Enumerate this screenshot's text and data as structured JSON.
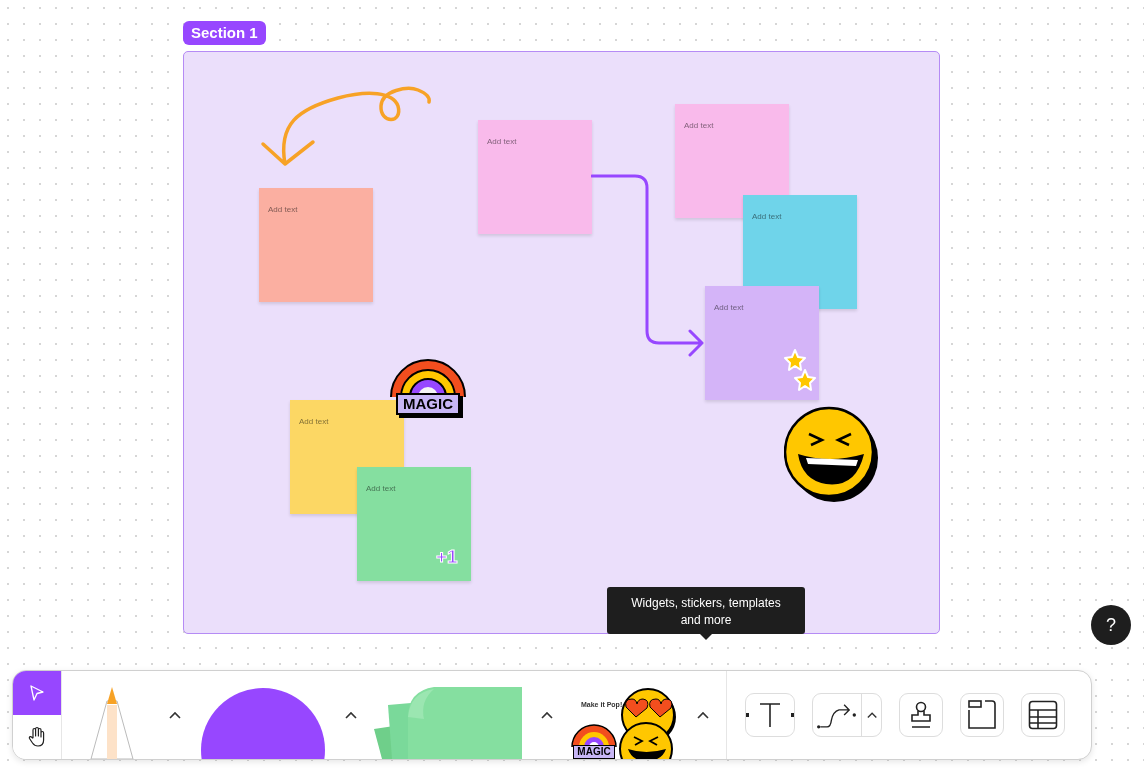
{
  "section": {
    "label": "Section 1"
  },
  "stickies": [
    {
      "text": "Add text",
      "color": "#fbafa1"
    },
    {
      "text": "Add text",
      "color": "#f9baeb"
    },
    {
      "text": "Add text",
      "color": "#f9baeb"
    },
    {
      "text": "Add text",
      "color": "#6fd4ea"
    },
    {
      "text": "Add text",
      "color": "#d4b4f8"
    },
    {
      "text": "Add text",
      "color": "#fcd764"
    },
    {
      "text": "Add text",
      "color": "#85dfa0"
    }
  ],
  "stickers": [
    {
      "kind": "rainbow",
      "text": "MAGIC"
    },
    {
      "kind": "plus",
      "text": "+1"
    },
    {
      "kind": "stars"
    },
    {
      "kind": "laugh"
    }
  ],
  "tooltip": {
    "text": "Widgets, stickers, templates and more"
  },
  "help": {
    "text": "?"
  },
  "toolbar": {
    "modes": [
      {
        "kind": "select",
        "selected": true
      },
      {
        "kind": "hand",
        "selected": false
      }
    ],
    "sticker_pack": {
      "pop_text": "Make it Pop!",
      "magic_text": "MAGIC"
    },
    "tools": [
      {
        "kind": "text"
      },
      {
        "kind": "connector"
      },
      {
        "kind": "stamp"
      },
      {
        "kind": "section"
      },
      {
        "kind": "table"
      }
    ]
  }
}
